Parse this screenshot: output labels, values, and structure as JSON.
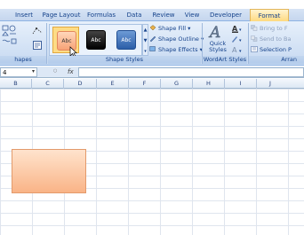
{
  "tabs": {
    "insert": "Insert",
    "page_layout": "Page Layout",
    "formulas": "Formulas",
    "data": "Data",
    "review": "Review",
    "view": "View",
    "developer": "Developer",
    "format": "Format"
  },
  "ribbon": {
    "shapes_group_label": "hapes",
    "shape_styles_label": "Shape Styles",
    "wordart_styles_label": "WordArt Styles",
    "arrange_label": "Arran",
    "style_thumbs": [
      "Abc",
      "Abc",
      "Abc"
    ],
    "shape_fill": "Shape Fill",
    "shape_outline": "Shape Outline",
    "shape_effects": "Shape Effects",
    "quick_styles_line1": "Quick",
    "quick_styles_line2": "Styles",
    "bring_to_front": "Bring to F",
    "send_to_back": "Send to Ba",
    "selection_pane": "Selection P"
  },
  "formula_bar": {
    "name_box": "4",
    "fx": "fx"
  },
  "columns": [
    "B",
    "C",
    "D",
    "E",
    "F",
    "G",
    "H",
    "I",
    "J"
  ],
  "colors": {
    "accent_tab": "#ffd87a",
    "shape_fill": "#f9b487",
    "ribbon_text": "#15428b"
  }
}
